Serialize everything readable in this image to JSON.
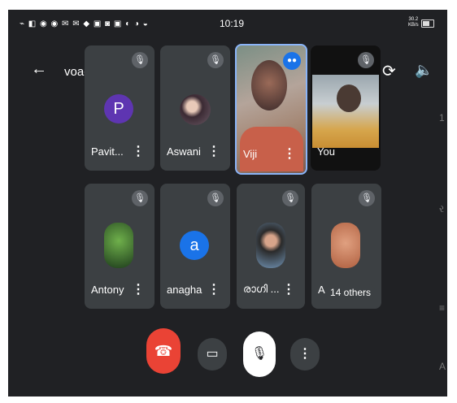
{
  "status_bar": {
    "icons": "⌁ ◧ ◉ ◉ ✉ ✉ ◆ ▣ ◙ ▣ ◐ ◑ ◒",
    "time": "10:19",
    "network_speed": "30.2",
    "network_unit": "KB/s"
  },
  "header": {
    "back_icon": "←",
    "meeting_code": "voa-uczk-jjn",
    "rotate_icon": "⟳",
    "speaker_icon": "🔈"
  },
  "tiles": [
    {
      "name": "Pavit...",
      "avatar_letter": "P",
      "avatar_color": "#5e35b1"
    },
    {
      "name": "Aswani"
    },
    {
      "name": "Viji",
      "active_speaker_color": "#8ab4f8"
    },
    {
      "name": "You"
    },
    {
      "name": "Antony"
    },
    {
      "name": "anagha",
      "avatar_letter": "a",
      "avatar_color": "#1a73e8"
    },
    {
      "name": "രാഗി ..."
    },
    {
      "name": "A",
      "overflow_label": "14 others"
    }
  ],
  "icons": {
    "mute": "🎙",
    "more": "⋮"
  },
  "controls": {
    "end_call_color": "#ea4335",
    "end_call_icon": "☎",
    "camera_icon": "▭",
    "mic_icon": "🎙",
    "more_icon": "⋮"
  }
}
